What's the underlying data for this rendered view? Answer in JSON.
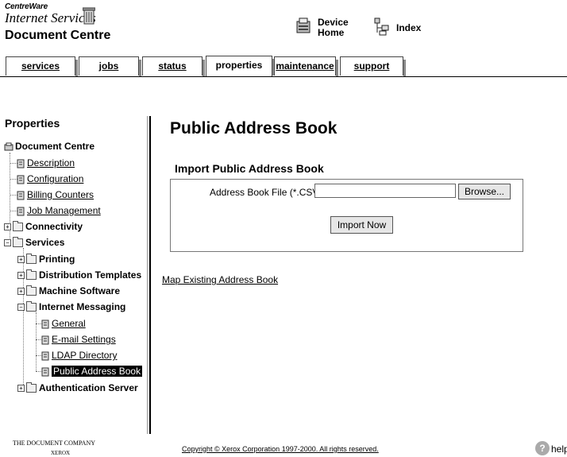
{
  "header": {
    "brand_line1": "CentreWare",
    "brand_line2": "Internet Services",
    "site_name": "Document Centre",
    "device_home_line1": "Device",
    "device_home_line2": "Home",
    "index_label": "Index"
  },
  "tabs": [
    {
      "label": "services",
      "active": false
    },
    {
      "label": "jobs",
      "active": false
    },
    {
      "label": "status",
      "active": false
    },
    {
      "label": "properties",
      "active": true
    },
    {
      "label": "maintenance",
      "active": false
    },
    {
      "label": "support",
      "active": false
    }
  ],
  "sidebar": {
    "title": "Properties",
    "root": "Document Centre",
    "items": [
      {
        "label": "Description",
        "type": "link"
      },
      {
        "label": "Configuration",
        "type": "link"
      },
      {
        "label": "Billing Counters",
        "type": "link"
      },
      {
        "label": "Job Management",
        "type": "link"
      },
      {
        "label": "Connectivity",
        "type": "folder",
        "expanded": false
      },
      {
        "label": "Services",
        "type": "folder",
        "expanded": true
      },
      {
        "label": "Printing",
        "type": "folder",
        "expanded": false
      },
      {
        "label": "Distribution Templates",
        "type": "folder",
        "expanded": false
      },
      {
        "label": "Machine Software",
        "type": "folder",
        "expanded": false
      },
      {
        "label": "Internet Messaging",
        "type": "folder",
        "expanded": true
      },
      {
        "label": "General",
        "type": "link"
      },
      {
        "label": "E-mail Settings",
        "type": "link"
      },
      {
        "label": "LDAP Directory",
        "type": "link"
      },
      {
        "label": "Public Address Book",
        "type": "link",
        "selected": true
      },
      {
        "label": "Authentication Server",
        "type": "folder",
        "expanded": false
      }
    ]
  },
  "main": {
    "title": "Public Address Book",
    "section_title": "Import Public Address Book",
    "file_label": "Address Book File (*.CSV):",
    "file_value": "",
    "browse_label": "Browse...",
    "import_label": "Import Now",
    "map_link": "Map Existing Address Book"
  },
  "footer": {
    "company_line1": "THE DOCUMENT COMPANY",
    "company_line2": "XEROX",
    "copyright": "Copyright © Xerox Corporation 1997-2000. All rights reserved.",
    "help": "help"
  }
}
